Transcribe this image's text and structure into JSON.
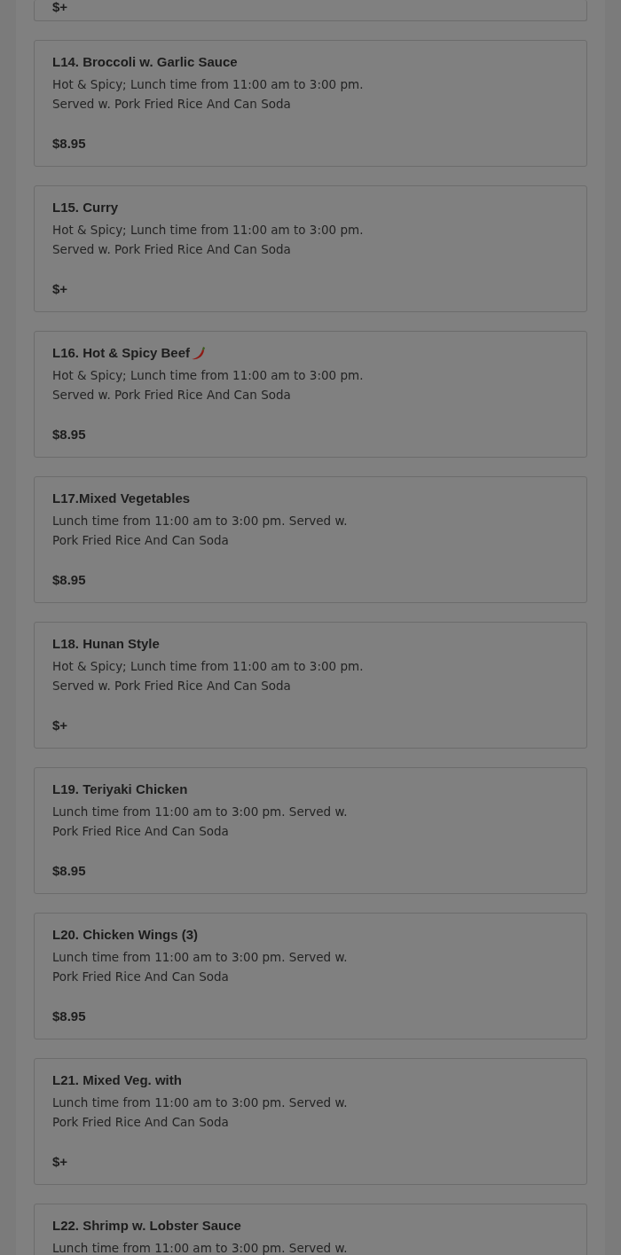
{
  "items": [
    {
      "price": "$+",
      "spicy": false
    },
    {
      "title": "L14. Broccoli w. Garlic Sauce",
      "lines": [
        "Hot & Spicy; Lunch time from 11:00 am to 3:00 pm.",
        "Served w. Pork Fried Rice And Can Soda"
      ],
      "price": "$8.95",
      "spicy": false
    },
    {
      "title": "L15. Curry",
      "lines": [
        "Hot & Spicy; Lunch time from 11:00 am to 3:00 pm.",
        "Served w. Pork Fried Rice And Can Soda"
      ],
      "price": "$+",
      "spicy": false
    },
    {
      "title": "L16. Hot & Spicy Beef",
      "lines": [
        "Hot & Spicy; Lunch time from 11:00 am to 3:00 pm.",
        "Served w. Pork Fried Rice And Can Soda"
      ],
      "price": "$8.95",
      "spicy": true
    },
    {
      "title": "L17.Mixed Vegetables",
      "lines": [
        "Lunch time from 11:00 am to 3:00 pm. Served w.",
        "Pork Fried Rice And Can Soda"
      ],
      "price": "$8.95",
      "spicy": false
    },
    {
      "title": "L18. Hunan Style",
      "lines": [
        "Hot & Spicy; Lunch time from 11:00 am to 3:00 pm.",
        "Served w. Pork Fried Rice And Can Soda"
      ],
      "price": "$+",
      "spicy": false
    },
    {
      "title": "L19. Teriyaki Chicken",
      "lines": [
        "Lunch time from 11:00 am to 3:00 pm. Served w.",
        "Pork Fried Rice And Can Soda"
      ],
      "price": "$8.95",
      "spicy": false
    },
    {
      "title": "L20. Chicken Wings (3)",
      "lines": [
        "Lunch time from 11:00 am to 3:00 pm. Served w.",
        "Pork Fried Rice And Can Soda"
      ],
      "price": "$8.95",
      "spicy": false
    },
    {
      "title": "L21. Mixed Veg. with",
      "lines": [
        "Lunch time from 11:00 am to 3:00 pm. Served w.",
        "Pork Fried Rice And Can Soda"
      ],
      "price": "$+",
      "spicy": false
    },
    {
      "title": "L22. Shrimp w. Lobster Sauce",
      "lines": [
        "Lunch time from 11:00 am to 3:00 pm. Served w."
      ],
      "spicy": false
    }
  ]
}
